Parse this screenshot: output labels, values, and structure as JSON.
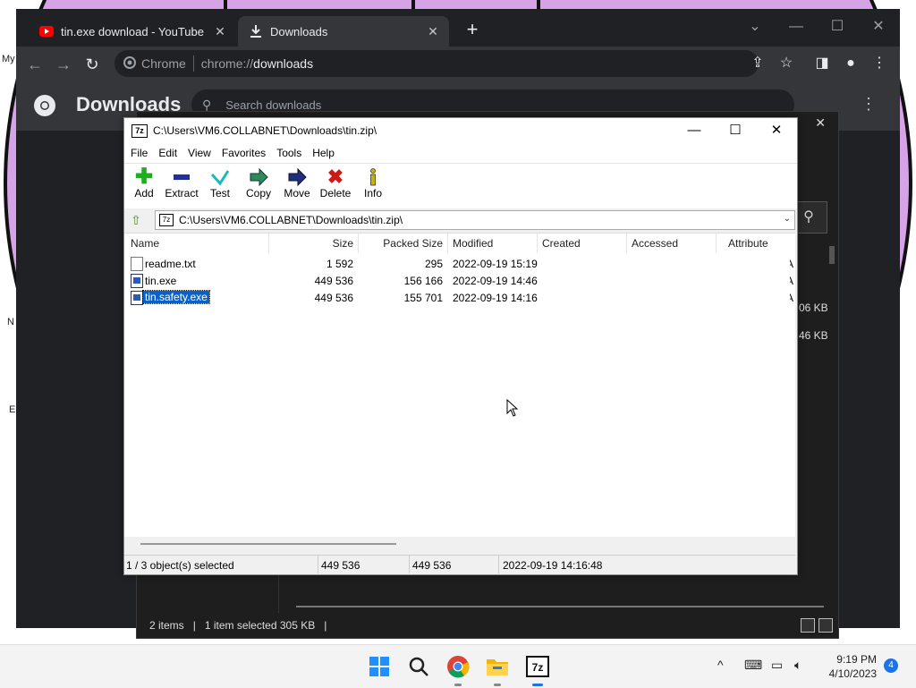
{
  "desktop": {
    "fragments": [
      "My",
      "N",
      "E"
    ]
  },
  "chrome": {
    "tabs": [
      {
        "title": "tin.exe download - YouTube",
        "icon": "youtube-icon",
        "active": false
      },
      {
        "title": "Downloads",
        "icon": "download-icon",
        "active": true
      }
    ],
    "omnibox": {
      "site": "Chrome",
      "scheme": "chrome://",
      "path": "downloads"
    },
    "page_title": "Downloads",
    "search_placeholder": "Search downloads"
  },
  "explorer": {
    "sizes": [
      "06 KB",
      "46 KB"
    ],
    "status": {
      "items": "2 items",
      "selected": "1 item selected  305 KB"
    }
  },
  "zip": {
    "title": "C:\\Users\\VM6.COLLABNET\\Downloads\\tin.zip\\",
    "app_icon": "7z",
    "menu": [
      "File",
      "Edit",
      "View",
      "Favorites",
      "Tools",
      "Help"
    ],
    "toolbar": [
      {
        "label": "Add",
        "icon": "plus-icon",
        "color": "#1fae1f"
      },
      {
        "label": "Extract",
        "icon": "minus-icon",
        "color": "#1e2f9e"
      },
      {
        "label": "Test",
        "icon": "check-icon",
        "color": "#20b8b8"
      },
      {
        "label": "Copy",
        "icon": "copy-arrow-icon",
        "color": "#2e8b57"
      },
      {
        "label": "Move",
        "icon": "move-arrow-icon",
        "color": "#1e2f7e"
      },
      {
        "label": "Delete",
        "icon": "delete-x-icon",
        "color": "#d01818"
      },
      {
        "label": "Info",
        "icon": "info-icon",
        "color": "#c8b400"
      }
    ],
    "address": "C:\\Users\\VM6.COLLABNET\\Downloads\\tin.zip\\",
    "columns": [
      "Name",
      "Size",
      "Packed Size",
      "Modified",
      "Created",
      "Accessed",
      "Attribute"
    ],
    "files": [
      {
        "name": "readme.txt",
        "size": "1 592",
        "packed": "295",
        "modified": "2022-09-19 15:19",
        "attr": "A",
        "type": "txt"
      },
      {
        "name": "tin.exe",
        "size": "449 536",
        "packed": "156 166",
        "modified": "2022-09-19 14:46",
        "attr": "A",
        "type": "exe"
      },
      {
        "name": "tin.safety.exe",
        "size": "449 536",
        "packed": "155 701",
        "modified": "2022-09-19 14:16",
        "attr": "A",
        "type": "exe",
        "selected": true
      }
    ],
    "status": {
      "selection": "1 / 3 object(s) selected",
      "size": "449 536",
      "packed": "449 536",
      "modified": "2022-09-19 14:16:48"
    }
  },
  "taskbar": {
    "apps": [
      "windows-start-icon",
      "search-icon",
      "chrome-icon",
      "file-explorer-icon",
      "7zip-icon"
    ],
    "time": "9:19 PM",
    "date": "4/10/2023",
    "notifications": "4"
  }
}
